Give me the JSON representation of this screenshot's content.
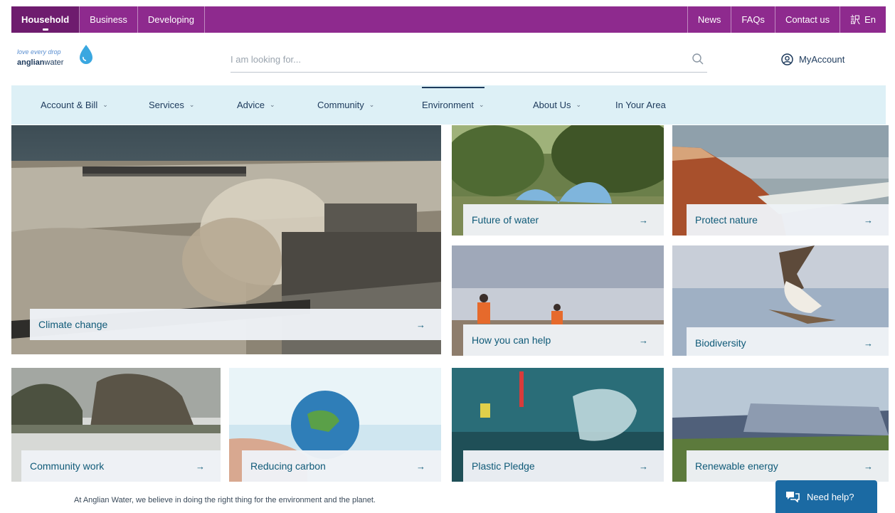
{
  "topbar": {
    "left": [
      "Household",
      "Business",
      "Developing"
    ],
    "right": [
      "News",
      "FAQs",
      "Contact us",
      "En"
    ]
  },
  "header": {
    "logo_tagline": "love every drop",
    "logo_brand_strong": "anglian",
    "logo_brand_rest": "water",
    "search_placeholder": "I am looking for...",
    "account_label": "MyAccount"
  },
  "nav": {
    "items": [
      "Account & Bill",
      "Services",
      "Advice",
      "Community",
      "Environment",
      "About Us",
      "In Your Area"
    ],
    "active": "Environment"
  },
  "tiles": {
    "climate": "Climate change",
    "future": "Future of water",
    "protect": "Protect nature",
    "help": "How you can help",
    "biodiversity": "Biodiversity",
    "community": "Community work",
    "carbon": "Reducing carbon",
    "plastic": "Plastic Pledge",
    "renewable": "Renewable energy",
    "arrow": "→"
  },
  "intro_text": "At Anglian Water, we believe in doing the right thing for the environment and the planet.",
  "help_button": "Need help?",
  "colors": {
    "topbar": "#8e2a8e",
    "nav": "#ddf0f6",
    "text_dark": "#1d3a5c",
    "tile_text": "#0f5a78",
    "help": "#1b6aa3"
  }
}
